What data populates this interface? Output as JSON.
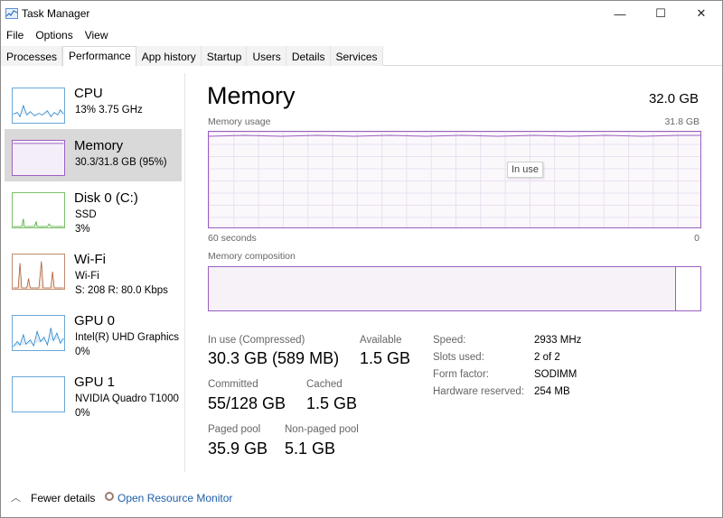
{
  "window": {
    "title": "Task Manager",
    "minimize": "—",
    "maximize": "☐",
    "close": "✕"
  },
  "menu": [
    "File",
    "Options",
    "View"
  ],
  "tabs": [
    "Processes",
    "Performance",
    "App history",
    "Startup",
    "Users",
    "Details",
    "Services"
  ],
  "active_tab": "Performance",
  "resources": [
    {
      "title": "CPU",
      "sub1": "13%  3.75 GHz",
      "sub2": "",
      "color": "#1e7fc9"
    },
    {
      "title": "Memory",
      "sub1": "30.3/31.8 GB (95%)",
      "sub2": "",
      "color": "#9b5fc0"
    },
    {
      "title": "Disk 0 (C:)",
      "sub1": "SSD",
      "sub2": "3%",
      "color": "#4aa832"
    },
    {
      "title": "Wi-Fi",
      "sub1": "Wi-Fi",
      "sub2": "S: 208  R: 80.0 Kbps",
      "color": "#a7562b"
    },
    {
      "title": "GPU 0",
      "sub1": "Intel(R) UHD Graphics",
      "sub2": "0%",
      "color": "#1e7fc9"
    },
    {
      "title": "GPU 1",
      "sub1": "NVIDIA Quadro T1000",
      "sub2": "0%",
      "color": "#1e7fc9"
    }
  ],
  "memory": {
    "title": "Memory",
    "total": "32.0 GB",
    "usage_label": "Memory usage",
    "usage_max": "31.8 GB",
    "tooltip": "In use",
    "time_left": "60 seconds",
    "time_right": "0",
    "composition_label": "Memory composition",
    "composition_inuse_fraction": 0.95,
    "stats": {
      "in_use_label": "In use (Compressed)",
      "in_use_value": "30.3 GB (589 MB)",
      "available_label": "Available",
      "available_value": "1.5 GB",
      "committed_label": "Committed",
      "committed_value": "55/128 GB",
      "cached_label": "Cached",
      "cached_value": "1.5 GB",
      "paged_label": "Paged pool",
      "paged_value": "35.9 GB",
      "nonpaged_label": "Non-paged pool",
      "nonpaged_value": "5.1 GB"
    },
    "specs": [
      {
        "label": "Speed:",
        "value": "2933 MHz"
      },
      {
        "label": "Slots used:",
        "value": "2 of 2"
      },
      {
        "label": "Form factor:",
        "value": "SODIMM"
      },
      {
        "label": "Hardware reserved:",
        "value": "254 MB"
      }
    ]
  },
  "footer": {
    "fewer_details": "Fewer details",
    "resource_monitor": "Open Resource Monitor"
  },
  "icons": {
    "chevron": "chevron-up-icon",
    "resource_monitor": "resource-monitor-icon",
    "app": "task-manager-icon"
  }
}
